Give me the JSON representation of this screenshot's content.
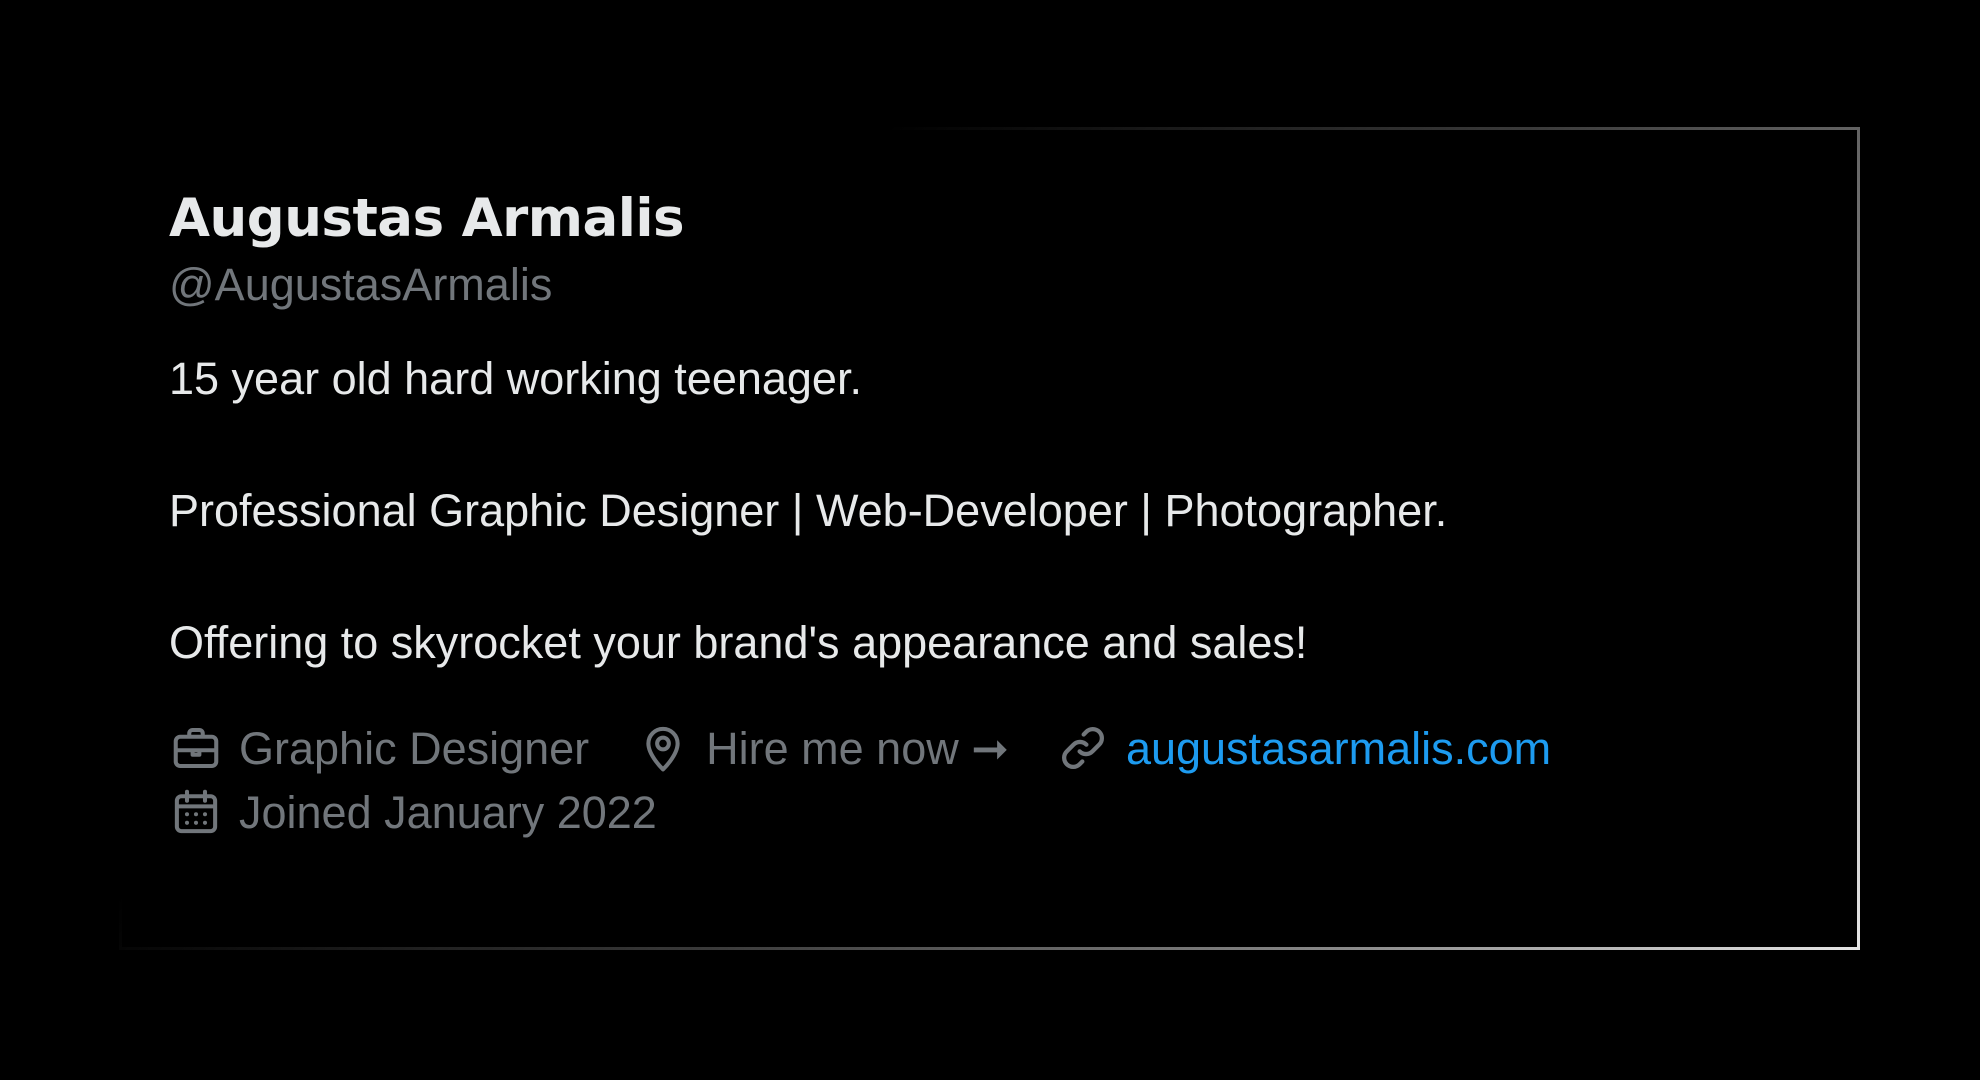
{
  "profile": {
    "display_name": "Augustas Armalis",
    "handle": "@AugustasArmalis",
    "bio": {
      "line1": "15 year old hard working teenager.",
      "line2": "Professional Graphic Designer | Web-Developer | Photographer.",
      "line3": "Offering to skyrocket your brand's appearance and sales!"
    },
    "meta": {
      "profession": "Graphic Designer",
      "location": "Hire me now ➞",
      "website": "augustasarmalis.com",
      "joined": "Joined January 2022"
    }
  },
  "icons": {
    "profession": "briefcase-icon",
    "location": "location-pin-icon",
    "website": "link-icon",
    "joined": "calendar-icon"
  },
  "colors": {
    "background": "#000000",
    "primary_text": "#e7e9ea",
    "secondary_text": "#71767b",
    "link": "#1d9bf0"
  }
}
